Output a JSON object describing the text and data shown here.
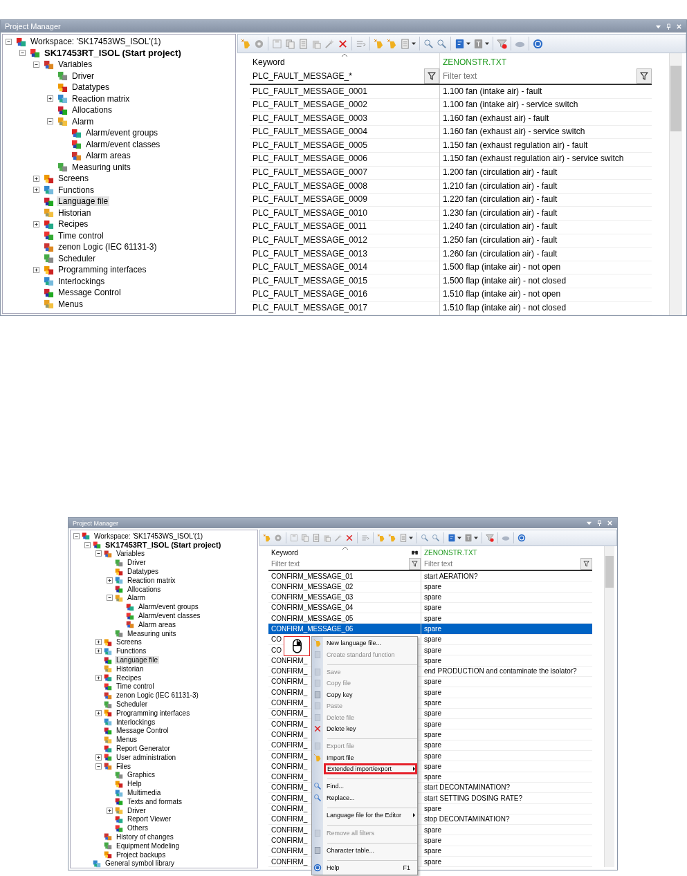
{
  "panels": [
    {
      "title": "Project Manager",
      "tree": [
        {
          "label": "Workspace: 'SK17453WS_ISOL'(1)",
          "selected": false,
          "expanded": true,
          "children": [
            {
              "label": "SK17453RT_ISOL (Start project)",
              "bold": true,
              "selected": false,
              "expanded": true,
              "children": [
                {
                  "label": "Variables",
                  "selected": false,
                  "expanded": true,
                  "children": [
                    {
                      "label": "Driver",
                      "selected": false
                    },
                    {
                      "label": "Datatypes",
                      "selected": false
                    },
                    {
                      "label": "Reaction matrix",
                      "selected": false,
                      "expanded": false
                    },
                    {
                      "label": "Allocations",
                      "selected": false
                    },
                    {
                      "label": "Alarm",
                      "selected": false,
                      "expanded": true,
                      "children": [
                        {
                          "label": "Alarm/event groups",
                          "selected": false
                        },
                        {
                          "label": "Alarm/event classes",
                          "selected": false
                        },
                        {
                          "label": "Alarm areas",
                          "selected": false
                        }
                      ]
                    },
                    {
                      "label": "Measuring units",
                      "selected": false
                    }
                  ]
                },
                {
                  "label": "Screens",
                  "selected": false,
                  "expanded": false
                },
                {
                  "label": "Functions",
                  "selected": false,
                  "expanded": false
                },
                {
                  "label": "Language file",
                  "selected": true
                },
                {
                  "label": "Historian",
                  "selected": false
                },
                {
                  "label": "Recipes",
                  "selected": false,
                  "expanded": false
                },
                {
                  "label": "Time control",
                  "selected": false
                },
                {
                  "label": "zenon Logic (IEC 61131-3)",
                  "selected": false
                },
                {
                  "label": "Scheduler",
                  "selected": false
                },
                {
                  "label": "Programming interfaces",
                  "selected": false,
                  "expanded": false
                },
                {
                  "label": "Interlockings",
                  "selected": false
                },
                {
                  "label": "Message Control",
                  "selected": false
                },
                {
                  "label": "Menus",
                  "selected": false
                }
              ]
            }
          ]
        }
      ],
      "table": {
        "columns": [
          {
            "label": "Keyword",
            "color": "#000000",
            "filter": {
              "value": "PLC_FAULT_MESSAGE_*"
            }
          },
          {
            "label": "ZENONSTR.TXT",
            "color": "#1e9a1e",
            "filter": {
              "placeholder": "Filter text"
            }
          }
        ],
        "rows": [
          {
            "keyword": "PLC_FAULT_MESSAGE_0001",
            "text": "1.100 fan (intake air) - fault",
            "selected": false
          },
          {
            "keyword": "PLC_FAULT_MESSAGE_0002",
            "text": "1.100 fan (intake air) - service switch",
            "selected": false
          },
          {
            "keyword": "PLC_FAULT_MESSAGE_0003",
            "text": "1.160 fan (exhaust air) - fault",
            "selected": false
          },
          {
            "keyword": "PLC_FAULT_MESSAGE_0004",
            "text": "1.160 fan (exhaust air) - service switch",
            "selected": false
          },
          {
            "keyword": "PLC_FAULT_MESSAGE_0005",
            "text": "1.150 fan (exhaust regulation air) - fault",
            "selected": false
          },
          {
            "keyword": "PLC_FAULT_MESSAGE_0006",
            "text": "1.150 fan (exhaust regulation air) - service switch",
            "selected": false
          },
          {
            "keyword": "PLC_FAULT_MESSAGE_0007",
            "text": "1.200 fan (circulation air) - fault",
            "selected": false
          },
          {
            "keyword": "PLC_FAULT_MESSAGE_0008",
            "text": "1.210 fan (circulation air) - fault",
            "selected": false
          },
          {
            "keyword": "PLC_FAULT_MESSAGE_0009",
            "text": "1.220 fan (circulation air) - fault",
            "selected": false
          },
          {
            "keyword": "PLC_FAULT_MESSAGE_0010",
            "text": "1.230 fan (circulation air) - fault",
            "selected": false
          },
          {
            "keyword": "PLC_FAULT_MESSAGE_0011",
            "text": "1.240 fan (circulation air) - fault",
            "selected": false
          },
          {
            "keyword": "PLC_FAULT_MESSAGE_0012",
            "text": "1.250 fan (circulation air) - fault",
            "selected": false
          },
          {
            "keyword": "PLC_FAULT_MESSAGE_0013",
            "text": "1.260 fan (circulation air) - fault",
            "selected": false
          },
          {
            "keyword": "PLC_FAULT_MESSAGE_0014",
            "text": "1.500 flap (intake air) - not open",
            "selected": false
          },
          {
            "keyword": "PLC_FAULT_MESSAGE_0015",
            "text": "1.500 flap (intake air) - not closed",
            "selected": false
          },
          {
            "keyword": "PLC_FAULT_MESSAGE_0016",
            "text": "1.510 flap (intake air) - not open",
            "selected": false
          },
          {
            "keyword": "PLC_FAULT_MESSAGE_0017",
            "text": "1.510 flap (intake air) - not closed",
            "selected": false
          }
        ]
      }
    },
    {
      "title": "Project Manager",
      "tree": [
        {
          "label": "Workspace: 'SK17453WS_ISOL'(1)",
          "selected": false,
          "expanded": true,
          "children": [
            {
              "label": "SK17453RT_ISOL (Start project)",
              "bold": true,
              "selected": false,
              "expanded": true,
              "children": [
                {
                  "label": "Variables",
                  "selected": false,
                  "expanded": true,
                  "children": [
                    {
                      "label": "Driver",
                      "selected": false
                    },
                    {
                      "label": "Datatypes",
                      "selected": false
                    },
                    {
                      "label": "Reaction matrix",
                      "selected": false,
                      "expanded": false
                    },
                    {
                      "label": "Allocations",
                      "selected": false
                    },
                    {
                      "label": "Alarm",
                      "selected": false,
                      "expanded": true,
                      "children": [
                        {
                          "label": "Alarm/event groups",
                          "selected": false
                        },
                        {
                          "label": "Alarm/event classes",
                          "selected": false
                        },
                        {
                          "label": "Alarm areas",
                          "selected": false
                        }
                      ]
                    },
                    {
                      "label": "Measuring units",
                      "selected": false
                    }
                  ]
                },
                {
                  "label": "Screens",
                  "selected": false,
                  "expanded": false
                },
                {
                  "label": "Functions",
                  "selected": false,
                  "expanded": false
                },
                {
                  "label": "Language file",
                  "selected": true
                },
                {
                  "label": "Historian",
                  "selected": false
                },
                {
                  "label": "Recipes",
                  "selected": false,
                  "expanded": false
                },
                {
                  "label": "Time control",
                  "selected": false
                },
                {
                  "label": "zenon Logic (IEC 61131-3)",
                  "selected": false
                },
                {
                  "label": "Scheduler",
                  "selected": false
                },
                {
                  "label": "Programming interfaces",
                  "selected": false,
                  "expanded": false
                },
                {
                  "label": "Interlockings",
                  "selected": false
                },
                {
                  "label": "Message Control",
                  "selected": false
                },
                {
                  "label": "Menus",
                  "selected": false
                },
                {
                  "label": "Report Generator",
                  "selected": false
                },
                {
                  "label": "User administration",
                  "selected": false,
                  "expanded": false
                },
                {
                  "label": "Files",
                  "selected": false,
                  "expanded": true,
                  "children": [
                    {
                      "label": "Graphics",
                      "selected": false
                    },
                    {
                      "label": "Help",
                      "selected": false
                    },
                    {
                      "label": "Multimedia",
                      "selected": false
                    },
                    {
                      "label": "Texts and formats",
                      "selected": false
                    },
                    {
                      "label": "Driver",
                      "selected": false,
                      "expanded": false
                    },
                    {
                      "label": "Report Viewer",
                      "selected": false
                    },
                    {
                      "label": "Others",
                      "selected": false
                    }
                  ]
                },
                {
                  "label": "History of changes",
                  "selected": false
                },
                {
                  "label": "Equipment Modeling",
                  "selected": false
                },
                {
                  "label": "Project backups",
                  "selected": false
                }
              ]
            },
            {
              "label": "General symbol library",
              "selected": false
            }
          ]
        }
      ],
      "table": {
        "columns": [
          {
            "label": "Keyword",
            "color": "#000000",
            "filter": {
              "placeholder": "Filter text"
            }
          },
          {
            "label": "ZENONSTR.TXT",
            "color": "#1e9a1e",
            "filter": {
              "placeholder": "Filter text"
            }
          }
        ],
        "rows": [
          {
            "keyword": "CONFIRM_MESSAGE_01",
            "text": "start AERATION?",
            "selected": false
          },
          {
            "keyword": "CONFIRM_MESSAGE_02",
            "text": "spare",
            "selected": false
          },
          {
            "keyword": "CONFIRM_MESSAGE_03",
            "text": "spare",
            "selected": false
          },
          {
            "keyword": "CONFIRM_MESSAGE_04",
            "text": "spare",
            "selected": false
          },
          {
            "keyword": "CONFIRM_MESSAGE_05",
            "text": "spare",
            "selected": false
          },
          {
            "keyword": "CONFIRM_MESSAGE_06",
            "text": "spare",
            "selected": true
          },
          {
            "keyword": "CO",
            "text": "spare",
            "selected": false
          },
          {
            "keyword": "CO",
            "text": "spare",
            "selected": false
          },
          {
            "keyword": "CONFIRM_",
            "text": "spare",
            "selected": false
          },
          {
            "keyword": "CONFIRM_",
            "text": "end PRODUCTION and contaminate the isolator?",
            "selected": false
          },
          {
            "keyword": "CONFIRM_",
            "text": "spare",
            "selected": false
          },
          {
            "keyword": "CONFIRM_",
            "text": "spare",
            "selected": false
          },
          {
            "keyword": "CONFIRM_",
            "text": "spare",
            "selected": false
          },
          {
            "keyword": "CONFIRM_",
            "text": "spare",
            "selected": false
          },
          {
            "keyword": "CONFIRM_",
            "text": "spare",
            "selected": false
          },
          {
            "keyword": "CONFIRM_",
            "text": "spare",
            "selected": false
          },
          {
            "keyword": "CONFIRM_",
            "text": "spare",
            "selected": false
          },
          {
            "keyword": "CONFIRM_",
            "text": "spare",
            "selected": false
          },
          {
            "keyword": "CONFIRM_",
            "text": "spare",
            "selected": false
          },
          {
            "keyword": "CONFIRM_",
            "text": "spare",
            "selected": false
          },
          {
            "keyword": "CONFIRM_",
            "text": "start DECONTAMINATION?",
            "selected": false
          },
          {
            "keyword": "CONFIRM_",
            "text": "start SETTING DOSING RATE?",
            "selected": false
          },
          {
            "keyword": "CONFIRM_",
            "text": "spare",
            "selected": false
          },
          {
            "keyword": "CONFIRM_",
            "text": "stop DECONTAMINATION?",
            "selected": false
          },
          {
            "keyword": "CONFIRM_",
            "text": "spare",
            "selected": false
          },
          {
            "keyword": "CONFIRM_",
            "text": "spare",
            "selected": false
          },
          {
            "keyword": "CONFIRM_",
            "text": "spare",
            "selected": false
          },
          {
            "keyword": "CONFIRM_",
            "text": "spare",
            "selected": false
          }
        ]
      },
      "context_menu": {
        "items": [
          {
            "kind": "item",
            "label": "New language file...",
            "disabled": false,
            "submenu": false,
            "highlighted": false
          },
          {
            "kind": "item",
            "label": "Create standard function",
            "disabled": true,
            "submenu": false,
            "highlighted": false
          },
          {
            "kind": "separator"
          },
          {
            "kind": "item",
            "label": "Save",
            "disabled": true,
            "submenu": false,
            "highlighted": false
          },
          {
            "kind": "item",
            "label": "Copy file",
            "disabled": true,
            "submenu": false,
            "highlighted": false
          },
          {
            "kind": "item",
            "label": "Copy key",
            "disabled": false,
            "submenu": false,
            "highlighted": false
          },
          {
            "kind": "item",
            "label": "Paste",
            "disabled": true,
            "submenu": false,
            "highlighted": false
          },
          {
            "kind": "item",
            "label": "Delete file",
            "disabled": true,
            "submenu": false,
            "highlighted": false
          },
          {
            "kind": "item",
            "label": "Delete key",
            "disabled": false,
            "submenu": false,
            "highlighted": false
          },
          {
            "kind": "separator"
          },
          {
            "kind": "item",
            "label": "Export file",
            "disabled": true,
            "submenu": false,
            "highlighted": false
          },
          {
            "kind": "item",
            "label": "Import file",
            "disabled": false,
            "submenu": false,
            "highlighted": false
          },
          {
            "kind": "item",
            "label": "Extended import/export",
            "disabled": false,
            "submenu": true,
            "highlighted": true
          },
          {
            "kind": "separator"
          },
          {
            "kind": "item",
            "label": "Find...",
            "disabled": false,
            "submenu": false,
            "highlighted": false
          },
          {
            "kind": "item",
            "label": "Replace...",
            "disabled": false,
            "submenu": false,
            "highlighted": false
          },
          {
            "kind": "separator"
          },
          {
            "kind": "item",
            "label": "Language file for the Editor",
            "disabled": false,
            "submenu": true,
            "highlighted": false
          },
          {
            "kind": "separator"
          },
          {
            "kind": "item",
            "label": "Remove all filters",
            "disabled": true,
            "submenu": false,
            "highlighted": false
          },
          {
            "kind": "separator"
          },
          {
            "kind": "item",
            "label": "Character table...",
            "disabled": false,
            "submenu": false,
            "highlighted": false
          },
          {
            "kind": "separator"
          },
          {
            "kind": "item",
            "label": "Help",
            "shortcut": "F1",
            "disabled": false,
            "submenu": false,
            "highlighted": false
          }
        ]
      }
    }
  ]
}
